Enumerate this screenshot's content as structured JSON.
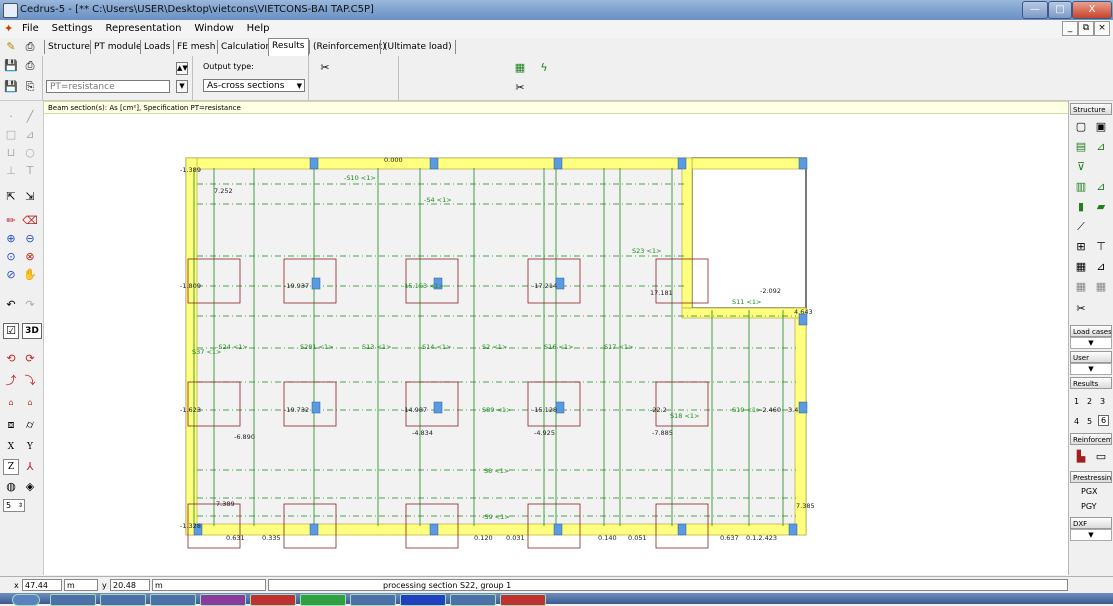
{
  "window": {
    "title": "Cedrus-5 - [** C:\\Users\\USER\\Desktop\\vietcons\\VIETCONS-BAI TAP.C5P]",
    "minimize": "—",
    "maximize": "□",
    "close": "X"
  },
  "menu": {
    "items": [
      "File",
      "Settings",
      "Representation",
      "Window",
      "Help"
    ],
    "doc_minimize": "_",
    "doc_restore": "⧉",
    "doc_close": "×"
  },
  "tabs": [
    {
      "label": "Structure",
      "active": false
    },
    {
      "label": "PT module",
      "active": false
    },
    {
      "label": "Loads",
      "active": false
    },
    {
      "label": "FE mesh",
      "active": false
    },
    {
      "label": "Calculation",
      "active": false
    },
    {
      "label": "Results",
      "active": true
    },
    {
      "label": "(Reinforcement)",
      "active": false
    },
    {
      "label": "(Ultimate load)",
      "active": false
    }
  ],
  "toolbar": {
    "pt_field": "PT=resistance",
    "output_type_label": "Output type:",
    "output_type_value": "As-cross sections"
  },
  "info_bar": "Beam section(s): As  [cm²],  Specification PT=resistance",
  "right_panel": {
    "structure_header": "Structure",
    "load_cases_header": "Load cases",
    "user_header": "User",
    "results_header": "Results",
    "results_numbers_top": [
      "1",
      "2",
      "3"
    ],
    "results_numbers_bottom": [
      "4",
      "5",
      "6"
    ],
    "reinforcement_header": "Reinforcem",
    "prestressing_header": "Prestressin",
    "pgx": "PGX",
    "pgy": "PGY",
    "dxf_header": "DXF"
  },
  "left_panel": {
    "label_3d": "3D",
    "axis_x": "X",
    "axis_y": "Y",
    "axis_z": "Z",
    "spinner_value": "5"
  },
  "drawing": {
    "labels": [
      "0.000",
      "-1.389",
      "7.252",
      "-S10 <1>",
      "-S4 <1>",
      "S23 <1>",
      "-1.809",
      "-19.937",
      "-15.1S3 <1>",
      "-17.214",
      "17.181",
      "-2.092",
      "S11 <1>",
      "4.643",
      "S37 <1>",
      "-S24 <1>",
      "S281 <1>",
      "S13 <1>",
      "S14 <1>",
      "S2 <1>",
      "S16 <1>",
      "S17 <1>",
      "-1.623",
      "-19.732",
      "-14.987",
      "S89 <1>",
      "-15.128",
      "-22.2",
      "S18 <1>",
      "S19 <1>",
      "-2.460",
      "3.4",
      "-6.890",
      "-4.834",
      "-4.925",
      "-7.885",
      "S8 <1>",
      "7.389",
      "-S9 <1>",
      "7.385",
      "-1.328",
      "0.631",
      "0.335",
      "0.120",
      "0.031",
      "0.140",
      "0.051",
      "0.637",
      "0.1.2.423"
    ]
  },
  "status": {
    "x_label": "x",
    "x_value": "47.44",
    "x_unit": "m",
    "y_label": "y",
    "y_value": "20.48",
    "y_unit": "m",
    "message": "processing section S22, group 1"
  },
  "colors": {
    "beam_fill": "#ffff80",
    "beam_stroke": "#b0a020",
    "slab": "#f2f2f2",
    "column": "#5a9ae0",
    "section_green": "#1a8a1a",
    "pad_outline": "#8b2020"
  }
}
